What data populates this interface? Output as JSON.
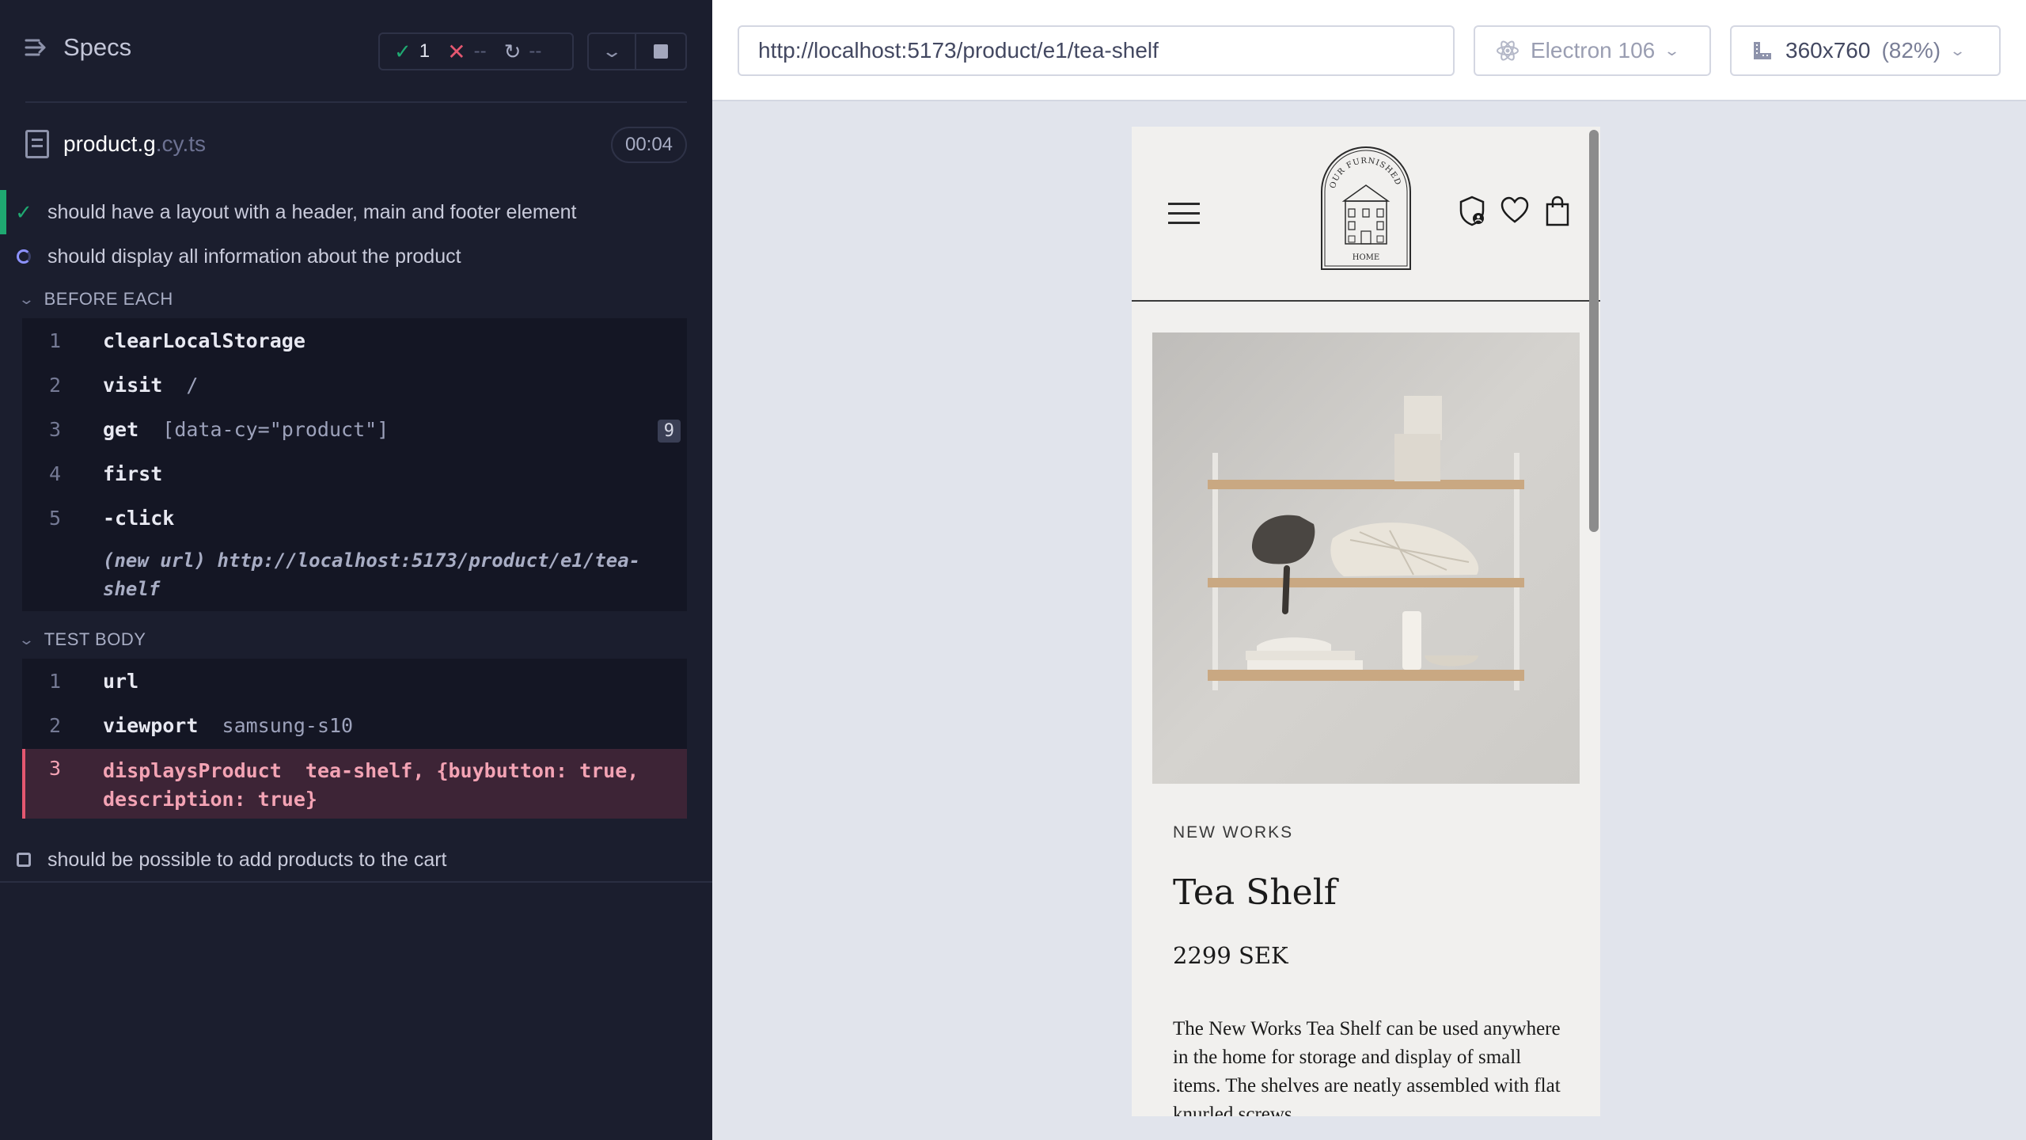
{
  "reporter": {
    "title": "Specs",
    "stats": {
      "passed": "1",
      "failed": "--",
      "pending": "--"
    },
    "file": {
      "name": "product.g",
      "ext": ".cy.ts",
      "duration": "00:04"
    },
    "tests": [
      {
        "title": "should have a layout with a header, main and footer element",
        "state": "passed"
      },
      {
        "title": "should display all information about the product",
        "state": "running"
      },
      {
        "title": "should be possible to add products to the cart",
        "state": "pending"
      }
    ],
    "before_each": {
      "label": "BEFORE EACH",
      "commands": [
        {
          "num": "1",
          "name": "clearLocalStorage",
          "arg": ""
        },
        {
          "num": "2",
          "name": "visit",
          "arg": "/"
        },
        {
          "num": "3",
          "name": "get",
          "arg": "[data-cy=\"product\"]",
          "badge": "9"
        },
        {
          "num": "4",
          "name": "first",
          "arg": ""
        },
        {
          "num": "5",
          "name": "-click",
          "arg": ""
        }
      ],
      "new_url": "(new url)  http://localhost:5173/product/e1/tea-shelf"
    },
    "test_body": {
      "label": "TEST BODY",
      "commands": [
        {
          "num": "1",
          "name": "url",
          "arg": ""
        },
        {
          "num": "2",
          "name": "viewport",
          "arg": "samsung-s10"
        },
        {
          "num": "3",
          "name": "displaysProduct",
          "arg": "tea-shelf, {buybutton: true, description: true}"
        }
      ]
    }
  },
  "aut": {
    "url": "http://localhost:5173/product/e1/tea-shelf",
    "browser": "Electron 106",
    "viewport": "360x760",
    "zoom": "(82%)"
  },
  "site": {
    "logo_top_text": "OUR FURNISHED",
    "logo_bottom_text": "HOME",
    "category": "NEW WORKS",
    "product_title": "Tea Shelf",
    "price": "2299 SEK",
    "description": "The New Works Tea Shelf can be used anywhere in the home for storage and display of small items. The shelves are neatly assembled with flat knurled screws"
  },
  "colors": {
    "pass": "#1fa971",
    "fail": "#e45770",
    "running": "#8d92ff",
    "panel_bg": "#1b1e2e"
  }
}
